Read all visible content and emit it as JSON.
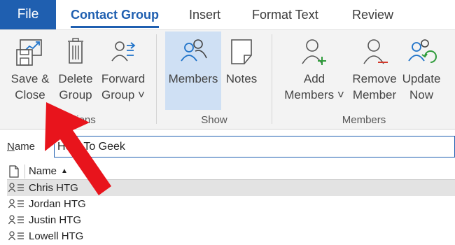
{
  "tabs": {
    "file": "File",
    "contact_group": "Contact Group",
    "insert": "Insert",
    "format_text": "Format Text",
    "review": "Review"
  },
  "ribbon": {
    "actions": {
      "group_label": "Actions",
      "visible_group_label": "ions",
      "save_close": [
        "Save &",
        "Close"
      ],
      "delete_group": [
        "Delete",
        "Group"
      ],
      "forward_group": [
        "Forward",
        "Group ˅"
      ]
    },
    "show": {
      "group_label": "Show",
      "members": "Members",
      "notes": "Notes"
    },
    "members": {
      "group_label": "Members",
      "add_members": [
        "Add",
        "Members ˅"
      ],
      "remove_member": [
        "Remove",
        "Member"
      ],
      "update_now": [
        "Update",
        "Now"
      ]
    }
  },
  "name_field": {
    "label_underlined": "N",
    "label_rest": "ame",
    "value": "How-To Geek"
  },
  "list": {
    "column_header": "Name",
    "sort_indicator": "▲",
    "rows": [
      "Chris HTG",
      "Jordan HTG",
      "Justin HTG",
      "Lowell HTG"
    ],
    "selected_index": 0
  },
  "colors": {
    "accent": "#1f5fb0",
    "icon_blue": "#1f73c9",
    "add_green": "#2e9b3a",
    "remove_red": "#d33a2c",
    "annotation_arrow": "#e8141c"
  }
}
